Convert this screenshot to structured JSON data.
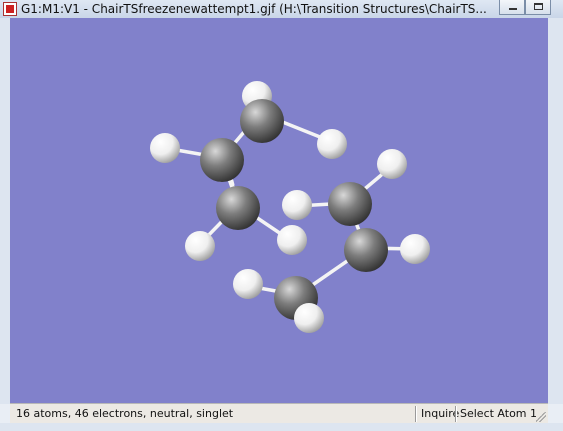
{
  "window": {
    "title": "G1:M1:V1 - ChairTSfreezenewattempt1.gjf (H:\\Transition Structures\\ChairTS..."
  },
  "viewport": {
    "background_color": "#8181cb",
    "carbon_color": "#7d7d7d",
    "hydrogen_color": "#efefef"
  },
  "statusbar": {
    "summary": "16 atoms, 46 electrons, neutral, singlet",
    "mode": "Inquire",
    "action": "Select Atom 1"
  }
}
